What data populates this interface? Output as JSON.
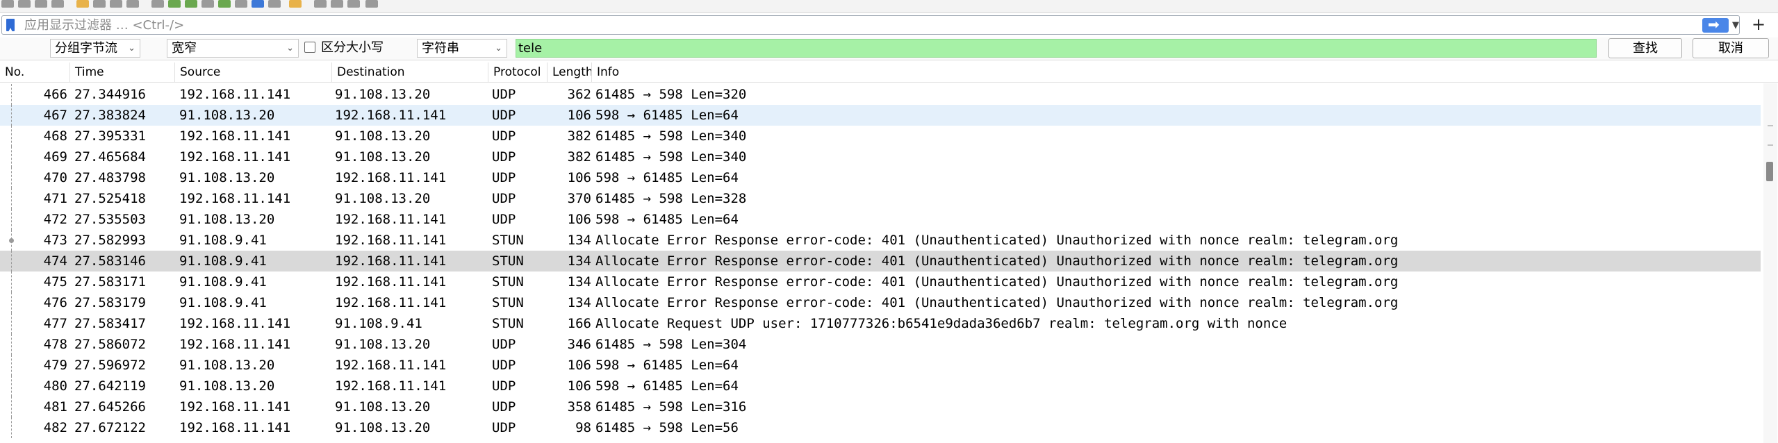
{
  "filter": {
    "placeholder": "应用显示过滤器 … <Ctrl-/>"
  },
  "search": {
    "scope": "分组字节流",
    "charset": "宽窄",
    "case_sensitive_label": "区分大小写",
    "type": "字符串",
    "value": "tele",
    "find_button": "查找",
    "cancel_button": "取消"
  },
  "columns": [
    "No.",
    "Time",
    "Source",
    "Destination",
    "Protocol",
    "Length",
    "Info"
  ],
  "packets": [
    {
      "no": "466",
      "time": "27.344916",
      "src": "192.168.11.141",
      "dst": "91.108.13.20",
      "proto": "UDP",
      "len": "362",
      "info": "61485 → 598 Len=320"
    },
    {
      "no": "467",
      "time": "27.383824",
      "src": "91.108.13.20",
      "dst": "192.168.11.141",
      "proto": "UDP",
      "len": "106",
      "info": "598 → 61485 Len=64"
    },
    {
      "no": "468",
      "time": "27.395331",
      "src": "192.168.11.141",
      "dst": "91.108.13.20",
      "proto": "UDP",
      "len": "382",
      "info": "61485 → 598 Len=340"
    },
    {
      "no": "469",
      "time": "27.465684",
      "src": "192.168.11.141",
      "dst": "91.108.13.20",
      "proto": "UDP",
      "len": "382",
      "info": "61485 → 598 Len=340"
    },
    {
      "no": "470",
      "time": "27.483798",
      "src": "91.108.13.20",
      "dst": "192.168.11.141",
      "proto": "UDP",
      "len": "106",
      "info": "598 → 61485 Len=64"
    },
    {
      "no": "471",
      "time": "27.525418",
      "src": "192.168.11.141",
      "dst": "91.108.13.20",
      "proto": "UDP",
      "len": "370",
      "info": "61485 → 598 Len=328"
    },
    {
      "no": "472",
      "time": "27.535503",
      "src": "91.108.13.20",
      "dst": "192.168.11.141",
      "proto": "UDP",
      "len": "106",
      "info": "598 → 61485 Len=64"
    },
    {
      "no": "473",
      "time": "27.582993",
      "src": "91.108.9.41",
      "dst": "192.168.11.141",
      "proto": "STUN",
      "len": "134",
      "info": "Allocate Error Response error-code: 401 (Unauthenticated) Unauthorized with nonce realm: telegram.org"
    },
    {
      "no": "474",
      "time": "27.583146",
      "src": "91.108.9.41",
      "dst": "192.168.11.141",
      "proto": "STUN",
      "len": "134",
      "info": "Allocate Error Response error-code: 401 (Unauthenticated) Unauthorized with nonce realm: telegram.org"
    },
    {
      "no": "475",
      "time": "27.583171",
      "src": "91.108.9.41",
      "dst": "192.168.11.141",
      "proto": "STUN",
      "len": "134",
      "info": "Allocate Error Response error-code: 401 (Unauthenticated) Unauthorized with nonce realm: telegram.org"
    },
    {
      "no": "476",
      "time": "27.583179",
      "src": "91.108.9.41",
      "dst": "192.168.11.141",
      "proto": "STUN",
      "len": "134",
      "info": "Allocate Error Response error-code: 401 (Unauthenticated) Unauthorized with nonce realm: telegram.org"
    },
    {
      "no": "477",
      "time": "27.583417",
      "src": "192.168.11.141",
      "dst": "91.108.9.41",
      "proto": "STUN",
      "len": "166",
      "info": "Allocate Request UDP user: 1710777326:b6541e9dada36ed6b7 realm: telegram.org with nonce"
    },
    {
      "no": "478",
      "time": "27.586072",
      "src": "192.168.11.141",
      "dst": "91.108.13.20",
      "proto": "UDP",
      "len": "346",
      "info": "61485 → 598 Len=304"
    },
    {
      "no": "479",
      "time": "27.596972",
      "src": "91.108.13.20",
      "dst": "192.168.11.141",
      "proto": "UDP",
      "len": "106",
      "info": "598 → 61485 Len=64"
    },
    {
      "no": "480",
      "time": "27.642119",
      "src": "91.108.13.20",
      "dst": "192.168.11.141",
      "proto": "UDP",
      "len": "106",
      "info": "598 → 61485 Len=64"
    },
    {
      "no": "481",
      "time": "27.645266",
      "src": "192.168.11.141",
      "dst": "91.108.13.20",
      "proto": "UDP",
      "len": "358",
      "info": "61485 → 598 Len=316"
    },
    {
      "no": "482",
      "time": "27.672122",
      "src": "192.168.11.141",
      "dst": "91.108.13.20",
      "proto": "UDP",
      "len": "98",
      "info": "61485 → 598 Len=56"
    }
  ],
  "highlight": {
    "light_row": "467",
    "grey_row": "474"
  },
  "colors": {
    "search_bg": "#a6f1a6",
    "selected_row": "#d9d9d9",
    "related_row": "#e4f0fb",
    "apply_button": "#4a86e8"
  }
}
